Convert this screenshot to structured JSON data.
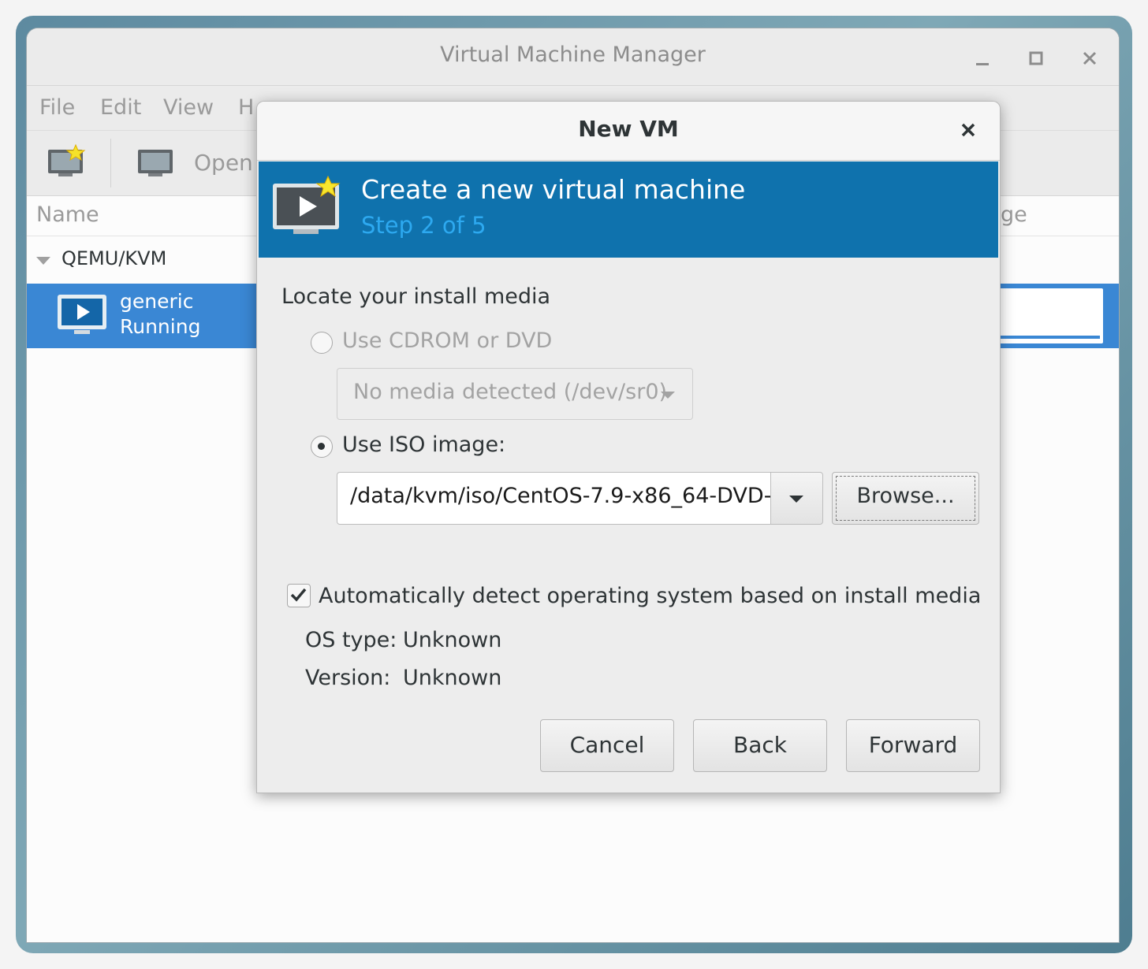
{
  "window": {
    "title": "Virtual Machine Manager"
  },
  "menu": {
    "file": "File",
    "edit": "Edit",
    "view": "View",
    "help": "H"
  },
  "toolbar": {
    "open_label": "Open"
  },
  "list": {
    "name_header": "Name",
    "partial_header": "ge",
    "group": "QEMU/KVM",
    "vm_name": "generic",
    "vm_status": "Running"
  },
  "dialog": {
    "title": "New VM",
    "banner_title": "Create a new virtual machine",
    "banner_step": "Step 2 of 5",
    "section_label": "Locate your install media",
    "cdrom_option": "Use CDROM or DVD",
    "cdrom_combo_value": "No media detected (/dev/sr0)",
    "iso_option": "Use ISO image:",
    "iso_path": "/data/kvm/iso/CentOS-7.9-x86_64-DVD-",
    "browse_label": "Browse...",
    "autodetect_label": "Automatically detect operating system based on install media",
    "autodetect_checked": true,
    "os_type_label": "OS type:",
    "os_type_value": "Unknown",
    "version_label": "Version:",
    "version_value": "Unknown",
    "cancel_label": "Cancel",
    "back_label": "Back",
    "forward_label": "Forward",
    "selected_option": "iso"
  },
  "colors": {
    "banner": "#0f72ad",
    "step_text": "#2da9f0",
    "selection": "#3a87d4"
  }
}
